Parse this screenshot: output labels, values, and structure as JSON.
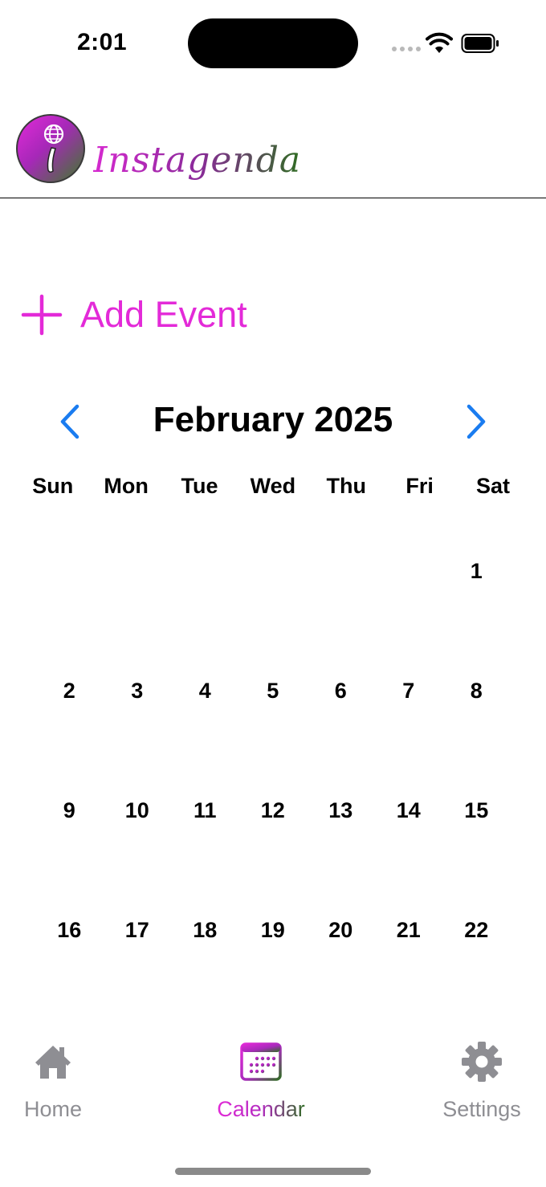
{
  "status_bar": {
    "time": "2:01"
  },
  "header": {
    "app_name": "Instagenda"
  },
  "add_event": {
    "label": "Add Event"
  },
  "calendar": {
    "month_title": "February 2025",
    "weekdays": [
      "Sun",
      "Mon",
      "Tue",
      "Wed",
      "Thu",
      "Fri",
      "Sat"
    ],
    "weeks": [
      [
        "",
        "",
        "",
        "",
        "",
        "",
        "1"
      ],
      [
        "2",
        "3",
        "4",
        "5",
        "6",
        "7",
        "8"
      ],
      [
        "9",
        "10",
        "11",
        "12",
        "13",
        "14",
        "15"
      ],
      [
        "16",
        "17",
        "18",
        "19",
        "20",
        "21",
        "22"
      ]
    ]
  },
  "tabs": [
    {
      "label": "Home",
      "icon": "house-icon"
    },
    {
      "label": "Calendar",
      "icon": "calendar-icon",
      "active": true
    },
    {
      "label": "Settings",
      "icon": "gear-icon"
    }
  ],
  "colors": {
    "accent_magenta": "#e32ad8",
    "accent_green": "#2e6d22",
    "nav_blue": "#1a7cf0",
    "tab_inactive": "#8e8e93"
  }
}
